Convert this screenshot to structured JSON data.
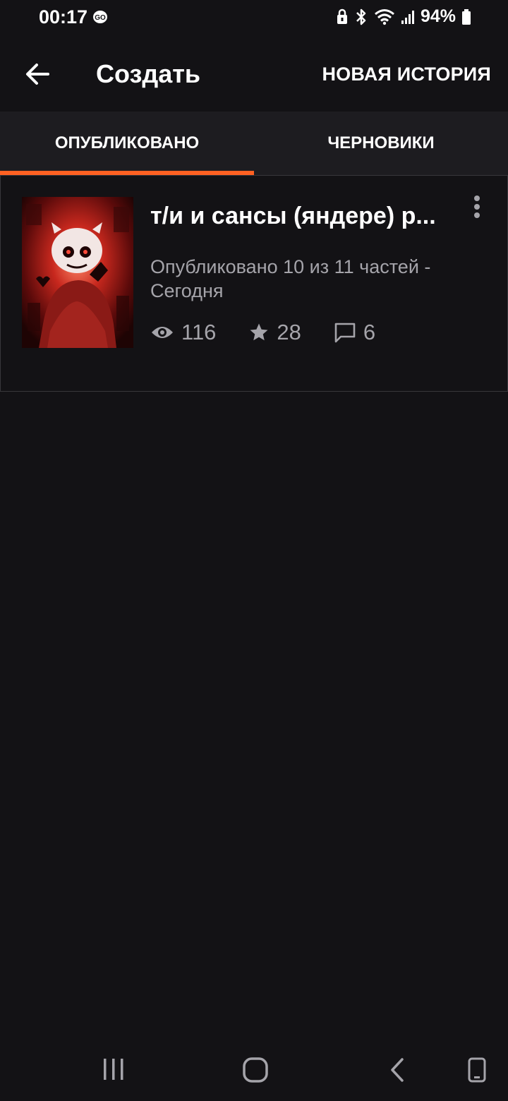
{
  "status_bar": {
    "time": "00:17",
    "battery": "94%"
  },
  "app_bar": {
    "title": "Создать",
    "new_story_label": "НОВАЯ ИСТОРИЯ"
  },
  "tabs": [
    {
      "label": "ОПУБЛИКОВАНО",
      "selected": true
    },
    {
      "label": "ЧЕРНОВИКИ",
      "selected": false
    }
  ],
  "stories": [
    {
      "title": "т/и  и сансы (яндере) р...",
      "meta": "Опубликовано 10 из 11 частей - Сегодня",
      "views": "116",
      "votes": "28",
      "comments": "6"
    }
  ],
  "colors": {
    "accent": "#ff6122",
    "background": "#131215",
    "tab_bar": "#1d1c20",
    "secondary_text": "#a5a4aa"
  },
  "icons": [
    "go-icon",
    "lock-icon",
    "bluetooth-icon",
    "wifi-icon",
    "signal-icon",
    "battery-icon",
    "back-arrow-icon",
    "more-vertical-icon",
    "eye-icon",
    "star-icon",
    "comment-icon",
    "recent-apps-icon",
    "home-icon",
    "back-icon",
    "rotate-icon"
  ]
}
